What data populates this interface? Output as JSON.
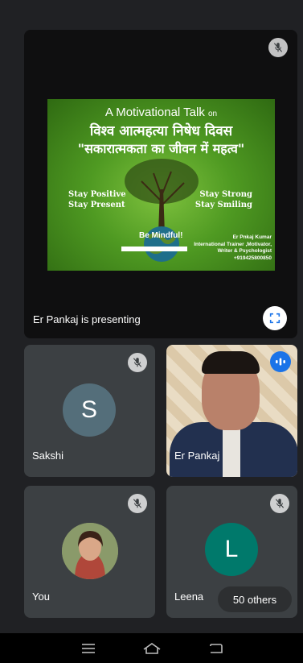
{
  "presentation": {
    "label": "Er Pankaj is presenting",
    "slide": {
      "title_main": "A Motivational Talk",
      "title_on": "on",
      "line_hindi_1": "विश्व आत्महत्या निषेध दिवस",
      "line_hindi_2": "\"सकारात्मकता का जीवन में  महत्व\"",
      "left_1": "Stay Positive",
      "left_2": "Stay Present",
      "right_1": "Stay Strong",
      "right_2": "Stay Smiling",
      "mindful": "Be Mindful!",
      "credit_1": "Er Pnkaj Kumar",
      "credit_2": "International Trainer ,Motivator,",
      "credit_3": "Writer & Psychologist",
      "credit_4": "+919425800850"
    }
  },
  "participants": [
    {
      "name": "Sakshi",
      "initial": "S",
      "avatar_color": "#546e7a",
      "muted": true
    },
    {
      "name": "Er Pankaj",
      "muted": false,
      "speaking": true
    },
    {
      "name": "You",
      "muted": true
    },
    {
      "name": "Leena",
      "initial": "L",
      "avatar_color": "#00796b",
      "muted": true
    }
  ],
  "others_label": "50 others",
  "icons": {
    "mic_off": "mic-off-icon",
    "speaking": "audio-level-icon",
    "fullscreen": "fullscreen-icon",
    "nav": [
      "recent-apps-icon",
      "home-icon",
      "back-icon"
    ]
  },
  "colors": {
    "speaking": "#1a73e8",
    "background": "#202124",
    "tile": "#3c4043"
  }
}
